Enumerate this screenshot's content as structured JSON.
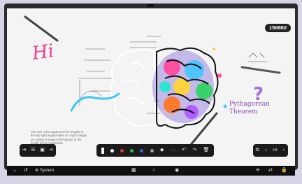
{
  "badge": "156860",
  "canvas": {
    "hi_text": "Hi",
    "pythagorean_line1": "Pythagorean",
    "pythagorean_line2": "Theorem",
    "question_mark": "?",
    "paragraph": "The sum of the squares of the lengths of the two right angled sides of a right triangle on a plane is equal to the square of the length of the hypotenuse"
  },
  "left_toolbar": {
    "icons": [
      "exit-icon",
      "menu-icon",
      "page-icon",
      "share-icon"
    ],
    "glyphs": [
      "⇥",
      "☰",
      "▣",
      "⋖"
    ]
  },
  "mid_toolbar": {
    "colors": [
      "#ffffff",
      "#e03a3a",
      "#2eb84a",
      "#3366e6",
      "#9a9a9a"
    ],
    "undo": "↶",
    "redo": "↷",
    "more": "···",
    "eraser": "◆",
    "delete": "🗑"
  },
  "right_toolbar": {
    "copy": "⧉",
    "prev": "‹",
    "page_indicator": "1/8",
    "next": "›"
  },
  "taskbar": {
    "back": "⌄",
    "return": "↺",
    "system_label": "System",
    "apps_icon": "▦",
    "home_icon": "⌂",
    "window_icon": "◉",
    "wifi_icon": "≋",
    "sync_icon": "⇄",
    "lock_icon": "🔒"
  },
  "colors": {
    "bezel": "#2b2b2e",
    "frame": "#d7d4e6",
    "hi": "#ee3d8a",
    "pythagorean": "#8a4fb1"
  }
}
